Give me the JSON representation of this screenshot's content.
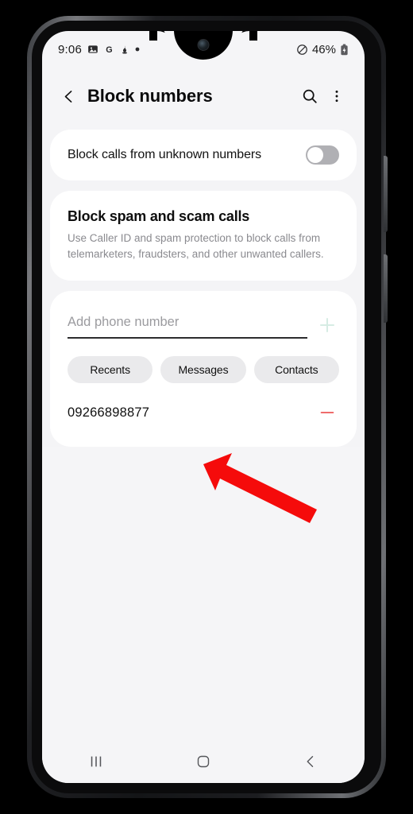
{
  "status_bar": {
    "time": "9:06",
    "left_icons": [
      "image-icon",
      "google-icon",
      "skype-icon",
      "dot-icon"
    ],
    "mute_icon": "do-not-disturb-icon",
    "battery_percent": "46%",
    "battery_icon": "battery-charging-icon"
  },
  "app_bar": {
    "back_icon": "back-chevron-icon",
    "title": "Block numbers",
    "search_icon": "search-icon",
    "more_icon": "more-vertical-icon"
  },
  "unknown_numbers": {
    "label": "Block calls from unknown numbers",
    "toggle_state": "off"
  },
  "spam_section": {
    "title": "Block spam and scam calls",
    "description": "Use Caller ID and spam protection to block calls from telemarketers, fraudsters, and other unwanted callers."
  },
  "add_number": {
    "value": "",
    "placeholder": "Add phone number",
    "add_icon": "plus-icon",
    "add_icon_color": "#d6ece4"
  },
  "source_chips": [
    {
      "label": "Recents",
      "name": "chip-recents"
    },
    {
      "label": "Messages",
      "name": "chip-messages"
    },
    {
      "label": "Contacts",
      "name": "chip-contacts"
    }
  ],
  "blocked_numbers": [
    {
      "number": "09266898877",
      "remove_icon": "minus-icon"
    }
  ],
  "annotation": {
    "shape": "arrow",
    "color": "#f50b0b",
    "points_to": "09266898877"
  },
  "nav_bar": {
    "recents_icon": "recents-icon",
    "home_icon": "home-icon",
    "back_icon": "back-chevron-icon"
  },
  "colors": {
    "page_background": "#f4f4f6",
    "card": "#ffffff",
    "chip": "#eaeaec",
    "remove_red": "#ef6b6b",
    "toggle_off_track": "#b0b0b4"
  }
}
